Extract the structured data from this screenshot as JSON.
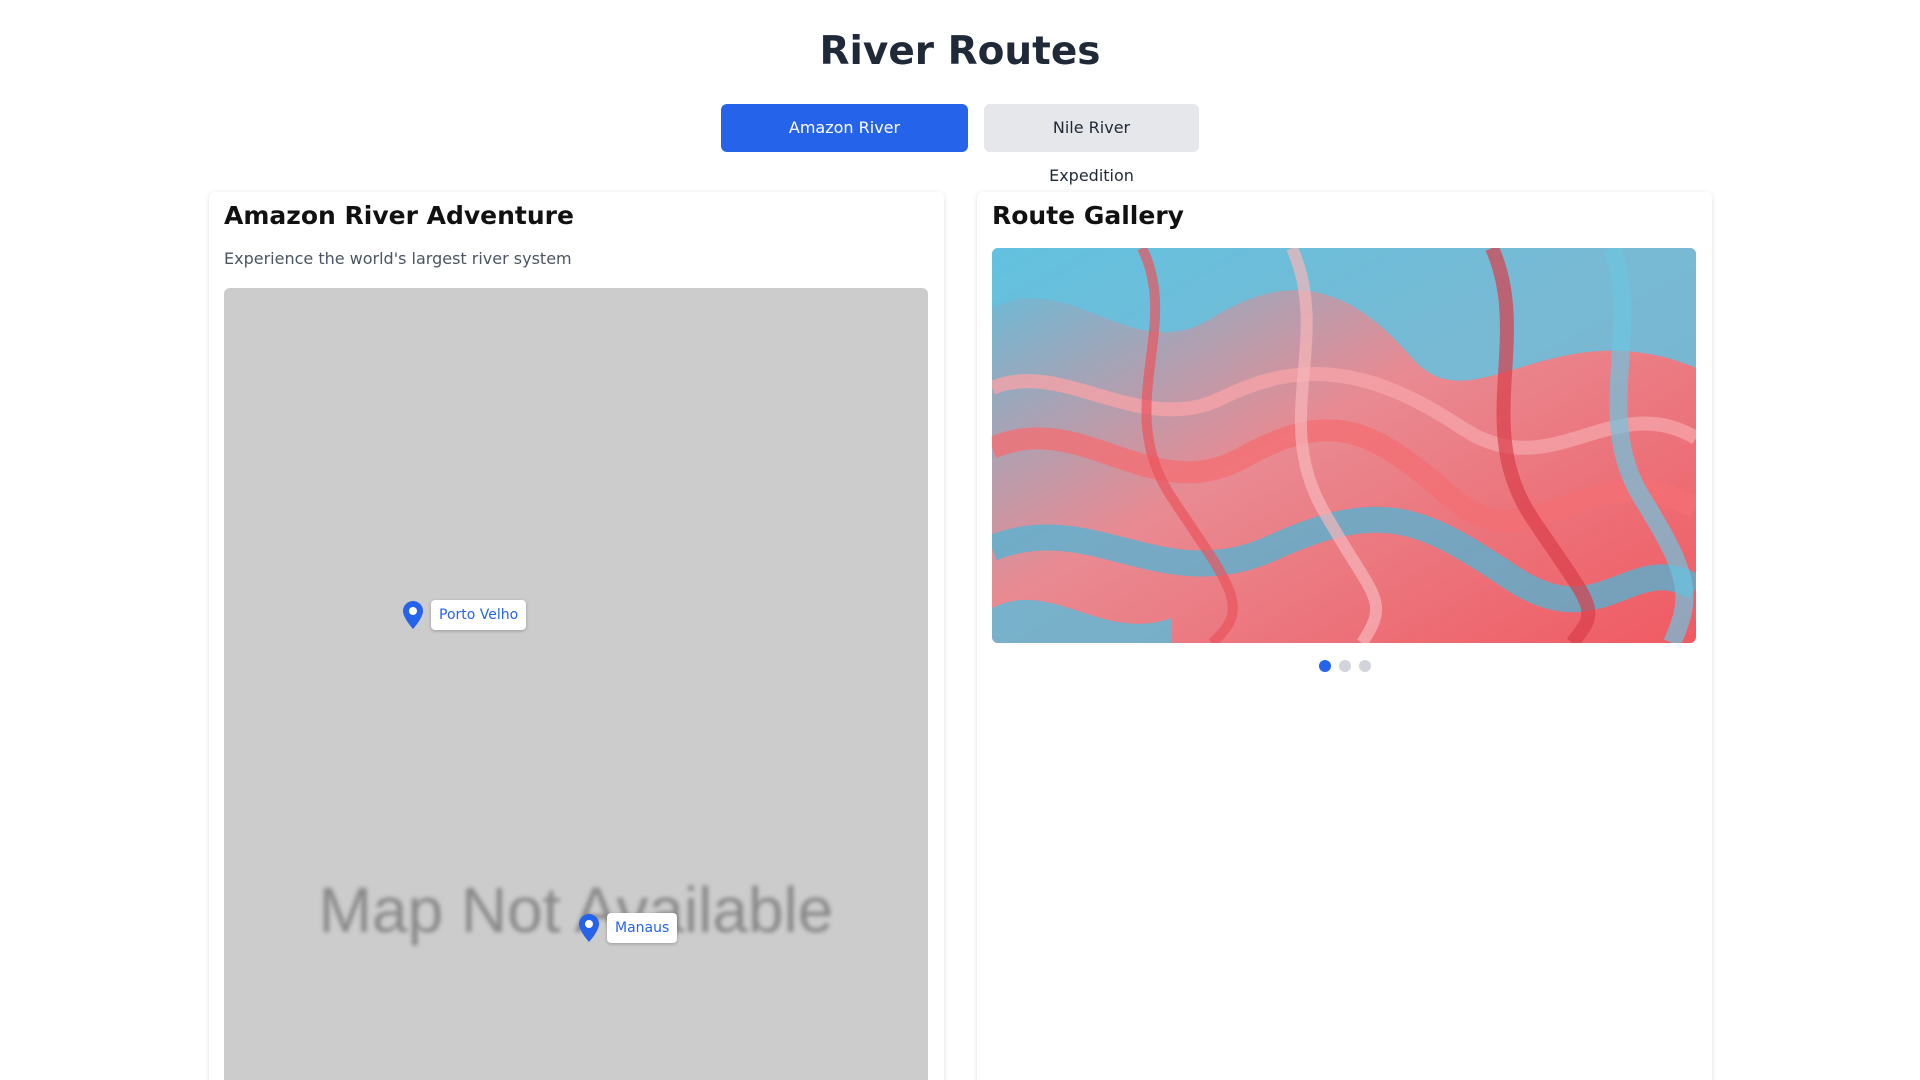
{
  "page": {
    "title": "River Routes"
  },
  "tabs": [
    {
      "label": "Amazon River Adventure",
      "active": true
    },
    {
      "label": "Nile River Expedition",
      "active": false
    }
  ],
  "route": {
    "title": "Amazon River Adventure",
    "subtitle": "Experience the world's largest river system",
    "map": {
      "placeholder_text": "Map Not Available",
      "markers": [
        {
          "label": "Porto Velho",
          "icon": "map-pin-icon"
        },
        {
          "label": "Manaus",
          "icon": "map-pin-icon"
        }
      ]
    }
  },
  "gallery": {
    "title": "Route Gallery",
    "slide_count": 3,
    "active_slide": 1
  },
  "colors": {
    "accent": "#2563eb",
    "tab_inactive": "#e5e7eb",
    "map_bg": "#cccccc",
    "gallery_blue": "#58b8d8",
    "gallery_red": "#f06a6a"
  }
}
